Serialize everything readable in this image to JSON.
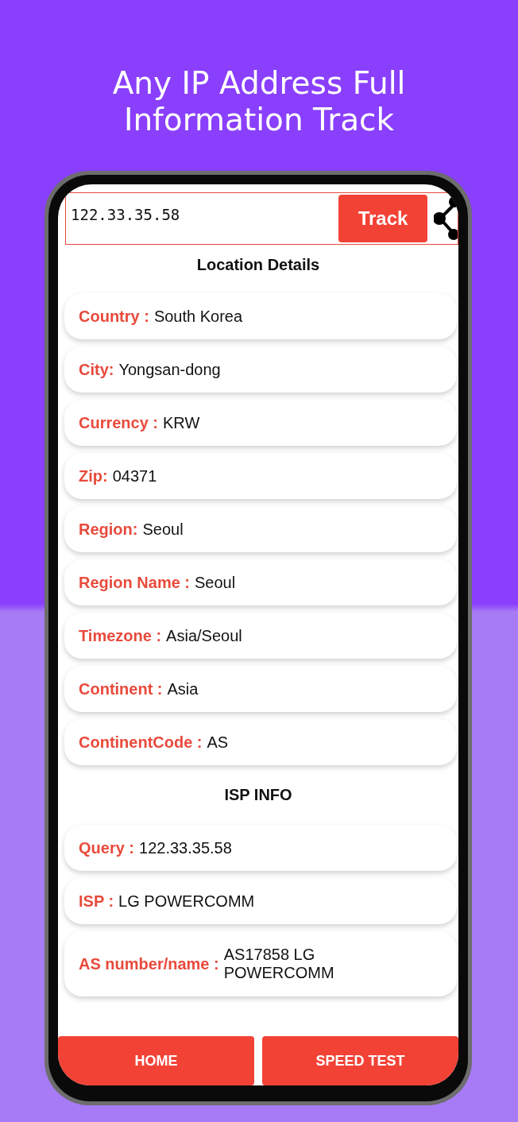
{
  "headline": [
    "Any IP Address Full",
    "Information Track"
  ],
  "search": {
    "value": "122.33.35.58",
    "button": "Track"
  },
  "location": {
    "title": "Location Details",
    "fields": [
      {
        "label": "Country :",
        "value": "South Korea"
      },
      {
        "label": "City:",
        "value": "Yongsan-dong"
      },
      {
        "label": "Currency :",
        "value": "KRW"
      },
      {
        "label": "Zip:",
        "value": "04371"
      },
      {
        "label": "Region:",
        "value": "Seoul"
      },
      {
        "label": "Region Name :",
        "value": "Seoul"
      },
      {
        "label": "Timezone :",
        "value": "Asia/Seoul"
      },
      {
        "label": "Continent :",
        "value": "Asia"
      },
      {
        "label": "ContinentCode :",
        "value": "AS"
      }
    ]
  },
  "isp": {
    "title": "ISP INFO",
    "fields": [
      {
        "label": "Query :",
        "value": "122.33.35.58"
      },
      {
        "label": "ISP :",
        "value": "LG POWERCOMM"
      },
      {
        "label": "AS number/name :",
        "value": "AS17858 LG POWERCOMM"
      }
    ]
  },
  "bottom_nav": [
    "HOME",
    "SPEED TEST"
  ]
}
